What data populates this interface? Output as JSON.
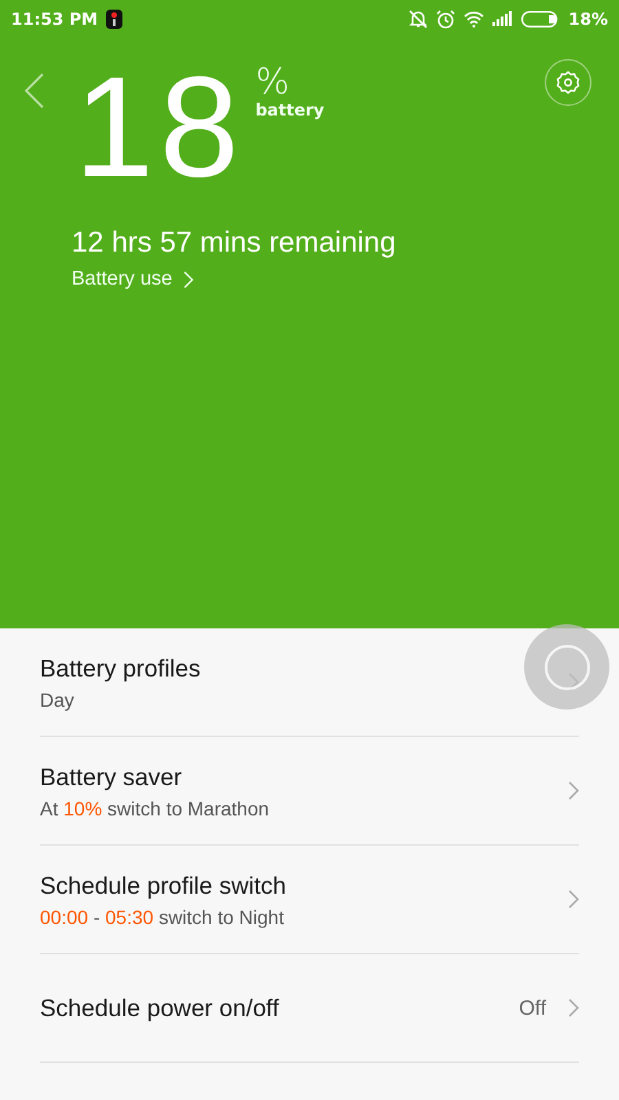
{
  "status_bar": {
    "time": "11:53 PM",
    "battery_level": "18%"
  },
  "header": {
    "percent": "18",
    "percent_sign": "%",
    "percent_label": "battery",
    "remaining": "12 hrs 57 mins remaining",
    "battery_use_link": "Battery use"
  },
  "settings": [
    {
      "title": "Battery profiles",
      "subtitle": [
        {
          "text": "Day",
          "highlight": false
        }
      ]
    },
    {
      "title": "Battery saver",
      "subtitle": [
        {
          "text": "At",
          "highlight": false
        },
        {
          "text": "10%",
          "highlight": true
        },
        {
          "text": "switch to Marathon",
          "highlight": false
        }
      ]
    },
    {
      "title": "Schedule profile switch",
      "subtitle": [
        {
          "text": "00:00",
          "highlight": true
        },
        {
          "text": "-",
          "highlight": false
        },
        {
          "text": "05:30",
          "highlight": true
        },
        {
          "text": "switch to Night",
          "highlight": false
        }
      ]
    },
    {
      "title": "Schedule power on/off",
      "value": "Off"
    }
  ]
}
